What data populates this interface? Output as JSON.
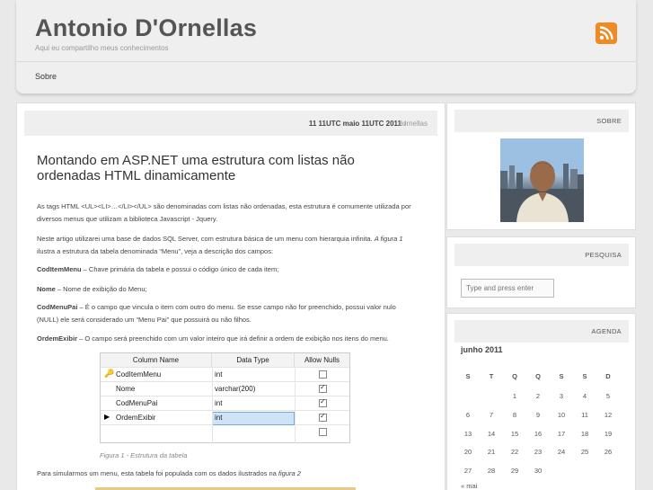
{
  "header": {
    "site_title": "Antonio D'Ornellas",
    "site_description": "Aqui eu compartilho meus conhecimentos",
    "nav_sobre": "Sobre"
  },
  "post": {
    "date": "11 11UTC maio 11UTC 2011",
    "separator": "/",
    "author": "dornellas",
    "title": "Montando em ASP.NET uma estrutura com listas não ordenadas HTML dinamicamente",
    "p1": "As tags HTML <UL><LI>…</LI></UL> são denominadas com listas não ordenadas, esta estrutura é comumente utilizada por diversos menus que utilizam a biblioteca Javascript  - Jquery.",
    "p2_a": "Neste artigo utilizarei uma base de dados SQL Server, com estrutura básica de um menu com  hierarquia infinita. ",
    "p2_b": "A figura 1",
    "p2_c": " ilustra a estrutura da tabela denominada “Menu”, veja a descrição dos campos:",
    "f1_name": "CodItemMenu",
    "f1_desc": " – Chave primária da tabela e possui o código único de cada item;",
    "f2_name": "Nome",
    "f2_desc": " – Nome de exibição do Menu;",
    "f3_name": "CodMenuPai",
    "f3_desc": " – É o campo que vincula o item com outro do menu. Se esse campo não for preenchido, possui valor nulo (NULL) ele será considerado um “Menu Pai” que possuirá ou não filhos.",
    "f4_name": "OrdemExibir",
    "f4_desc": " – O campo será preenchido com um valor inteiro que irá definir a ordem de exibição nos itens do menu.",
    "figure_caption": "Figura 1 - Estrutura da tabela",
    "p3_a": "Para simularmos um menu, esta tabela foi populada com os dados ilustrados na ",
    "p3_b": "figura 2"
  },
  "db_table": {
    "headers": [
      "Column Name",
      "Data Type",
      "Allow Nulls"
    ],
    "rows": [
      {
        "name": "CodItemMenu",
        "type": "int",
        "nulls": false,
        "marker": "key"
      },
      {
        "name": "Nome",
        "type": "varchar(200)",
        "nulls": true,
        "marker": ""
      },
      {
        "name": "CodMenuPai",
        "type": "int",
        "nulls": true,
        "marker": ""
      },
      {
        "name": "OrdemExibir",
        "type": "int",
        "nulls": true,
        "marker": "arrow"
      },
      {
        "name": "",
        "type": "",
        "nulls": false,
        "marker": ""
      }
    ]
  },
  "sidebar": {
    "about_title": "SOBRE",
    "search_title": "PESQUISA",
    "search_placeholder": "Type and press enter",
    "agenda_title": "AGENDA",
    "calendar": {
      "caption": "junho 2011",
      "weekdays": [
        "S",
        "T",
        "Q",
        "Q",
        "S",
        "S",
        "D"
      ],
      "weeks": [
        [
          "",
          "",
          "1",
          "2",
          "3",
          "4",
          "5"
        ],
        [
          "6",
          "7",
          "8",
          "9",
          "10",
          "11",
          "12"
        ],
        [
          "13",
          "14",
          "15",
          "16",
          "17",
          "18",
          "19"
        ],
        [
          "20",
          "21",
          "22",
          "23",
          "24",
          "25",
          "26"
        ],
        [
          "27",
          "28",
          "29",
          "30",
          "",
          "",
          ""
        ]
      ],
      "prev_link": "« mai"
    }
  },
  "colors": {
    "rss": "#f08a24",
    "panel_header": "#efefef",
    "background": "#e9e9e9"
  }
}
